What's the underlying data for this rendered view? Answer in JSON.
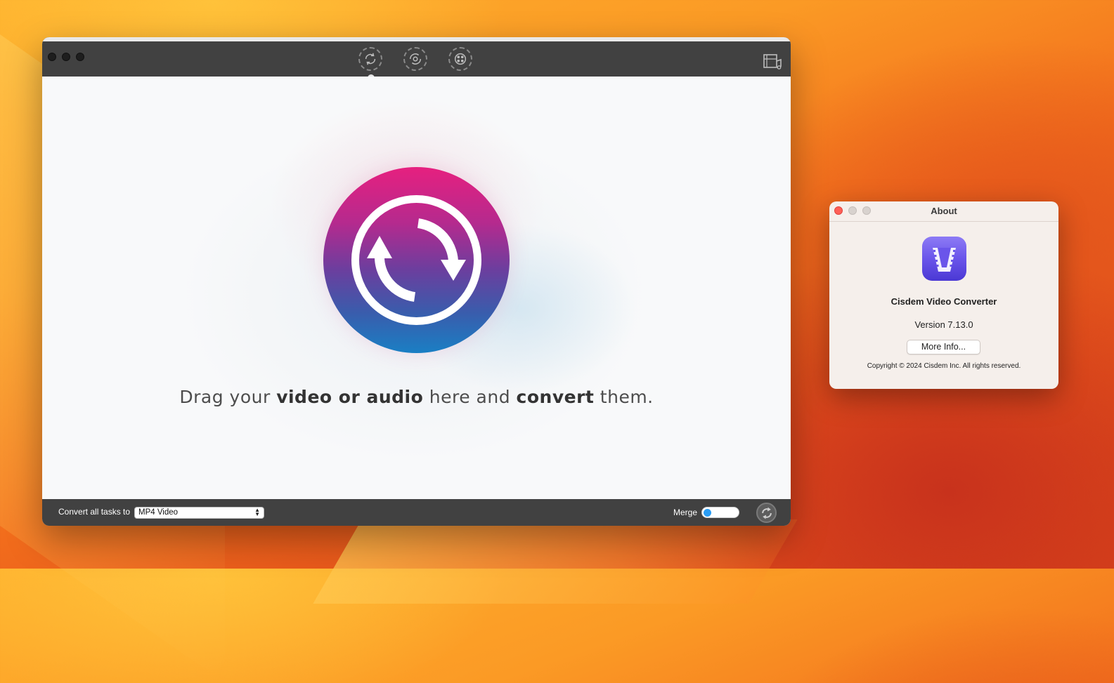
{
  "main_window": {
    "toolbar": {
      "icons": [
        "convert-icon",
        "rip-icon",
        "download-icon"
      ],
      "right_icon": "film-music-icon"
    },
    "drop_area": {
      "text_part1": "Drag your ",
      "text_bold1": "video or audio",
      "text_part2": " here and ",
      "text_bold2": "convert",
      "text_part3": " them."
    },
    "bottom_bar": {
      "convert_label": "Convert all tasks to",
      "format_value": "MP4 Video",
      "merge_label": "Merge",
      "merge_enabled": false
    },
    "colors": {
      "titlebar": "#414141",
      "logo_top": "#e6207f",
      "logo_bottom": "#1a7fc4",
      "toggle_knob": "#2a9df4"
    }
  },
  "about_window": {
    "title": "About",
    "app_name": "Cisdem Video Converter",
    "version": "Version 7.13.0",
    "more_info_label": "More Info...",
    "copyright": "Copyright © 2024 Cisdem Inc. All rights reserved.",
    "icon": "app-icon-film-v"
  }
}
